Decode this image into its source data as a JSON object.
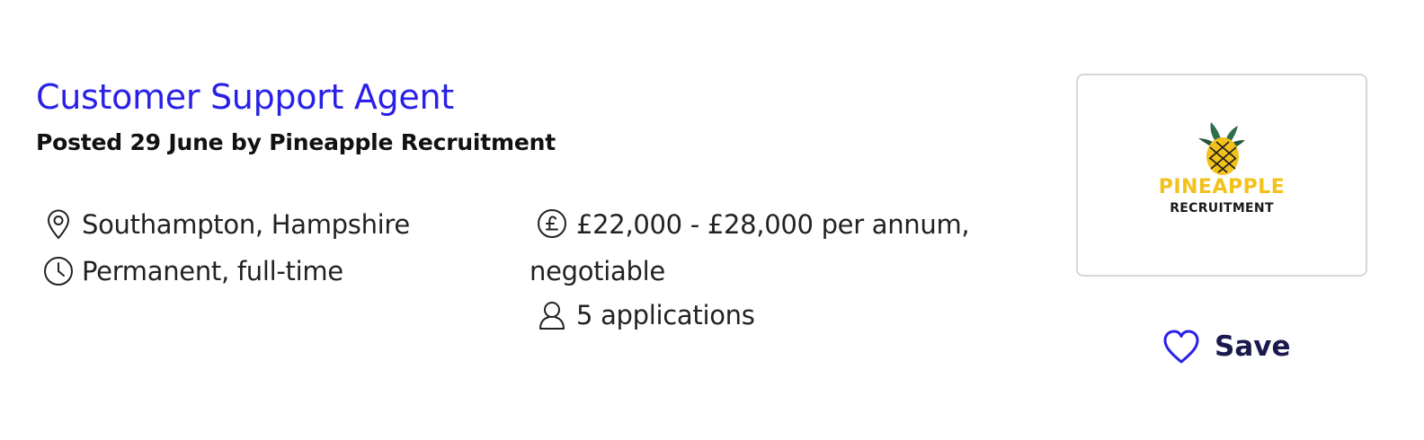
{
  "job": {
    "title": "Customer Support Agent",
    "posted": "Posted 29 June by Pineapple Recruitment",
    "location": "Southampton, Hampshire",
    "contract": "Permanent, full-time",
    "salary_line1": "£22,000 - £28,000 per annum,",
    "salary_line2": "negotiable",
    "applications": "5 applications"
  },
  "company_logo": {
    "word1": "PINEAPPLE",
    "word2": "RECRUITMENT"
  },
  "save": {
    "label": "Save"
  },
  "colors": {
    "title": "#2a21e8",
    "save_icon": "#2a21e8",
    "logo_yellow": "#f2c21b",
    "logo_green": "#2f6e4b"
  },
  "icons": {
    "location": "map-pin-icon",
    "contract": "clock-icon",
    "salary": "pound-circle-icon",
    "applications": "person-icon",
    "save": "heart-icon"
  }
}
